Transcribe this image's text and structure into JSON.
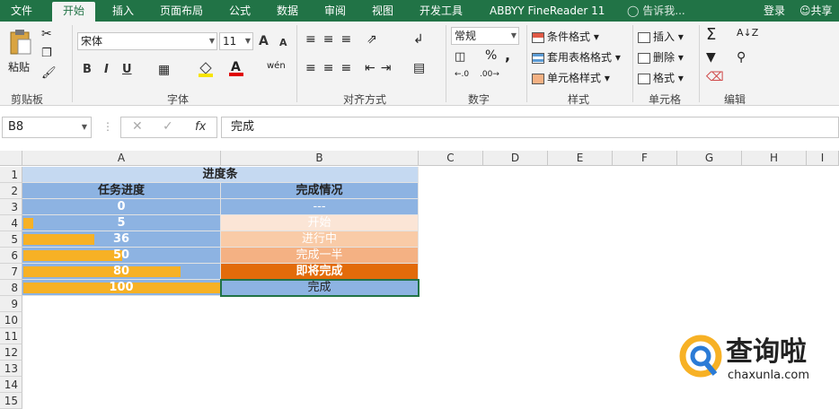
{
  "tabs": [
    "文件",
    "开始",
    "插入",
    "页面布局",
    "公式",
    "数据",
    "审阅",
    "视图",
    "开发工具",
    "ABBYY FineReader 11",
    "告诉我..."
  ],
  "login": "登录",
  "share": "共享",
  "ribbon": {
    "clipboard": {
      "paste": "粘贴",
      "label": "剪贴板"
    },
    "font": {
      "name": "宋体",
      "size": "11",
      "label": "字体",
      "bold": "B",
      "italic": "I",
      "underline": "U",
      "grow": "A",
      "shrink": "A",
      "wen": "wén"
    },
    "align": {
      "label": "对齐方式"
    },
    "number": {
      "format": "常规",
      "percent": "%",
      "comma": ",",
      "label": "数字"
    },
    "styles": {
      "conditional": "条件格式",
      "table": "套用表格格式",
      "cell": "单元格样式",
      "label": "样式"
    },
    "cells": {
      "insert": "插入",
      "delete": "删除",
      "format": "格式",
      "label": "单元格"
    },
    "edit": {
      "label": "编辑"
    }
  },
  "formula_bar": {
    "name_box": "B8",
    "fx": "fx",
    "value": "完成"
  },
  "columns": [
    "A",
    "B",
    "C",
    "D",
    "E",
    "F",
    "G",
    "H",
    "I"
  ],
  "rows": [
    "1",
    "2",
    "3",
    "4",
    "5",
    "6",
    "7",
    "8",
    "9",
    "10",
    "11",
    "12",
    "13",
    "14",
    "15"
  ],
  "sheet": {
    "title": "进度条",
    "header_a": "任务进度",
    "header_b": "完成情况",
    "progress": [
      {
        "value": 0,
        "label": "0",
        "status": "---"
      },
      {
        "value": 5,
        "label": "5",
        "status": "开始"
      },
      {
        "value": 36,
        "label": "36",
        "status": "进行中"
      },
      {
        "value": 50,
        "label": "50",
        "status": "完成一半"
      },
      {
        "value": 80,
        "label": "80",
        "status": "即将完成"
      },
      {
        "value": 100,
        "label": "100",
        "status": "完成"
      }
    ]
  },
  "colors": {
    "header_fill": "#8db3e2",
    "title_fill": "#c5d9f1",
    "bar": "#f7b125",
    "status_fills": [
      "#8db3e2",
      "#fbe5d6",
      "#f9cba7",
      "#f4b183",
      "#e26b0a",
      "#8db3e2"
    ],
    "brand_green": "#217346"
  },
  "watermark": {
    "brand": "查询啦",
    "url": "chaxunla.com"
  }
}
